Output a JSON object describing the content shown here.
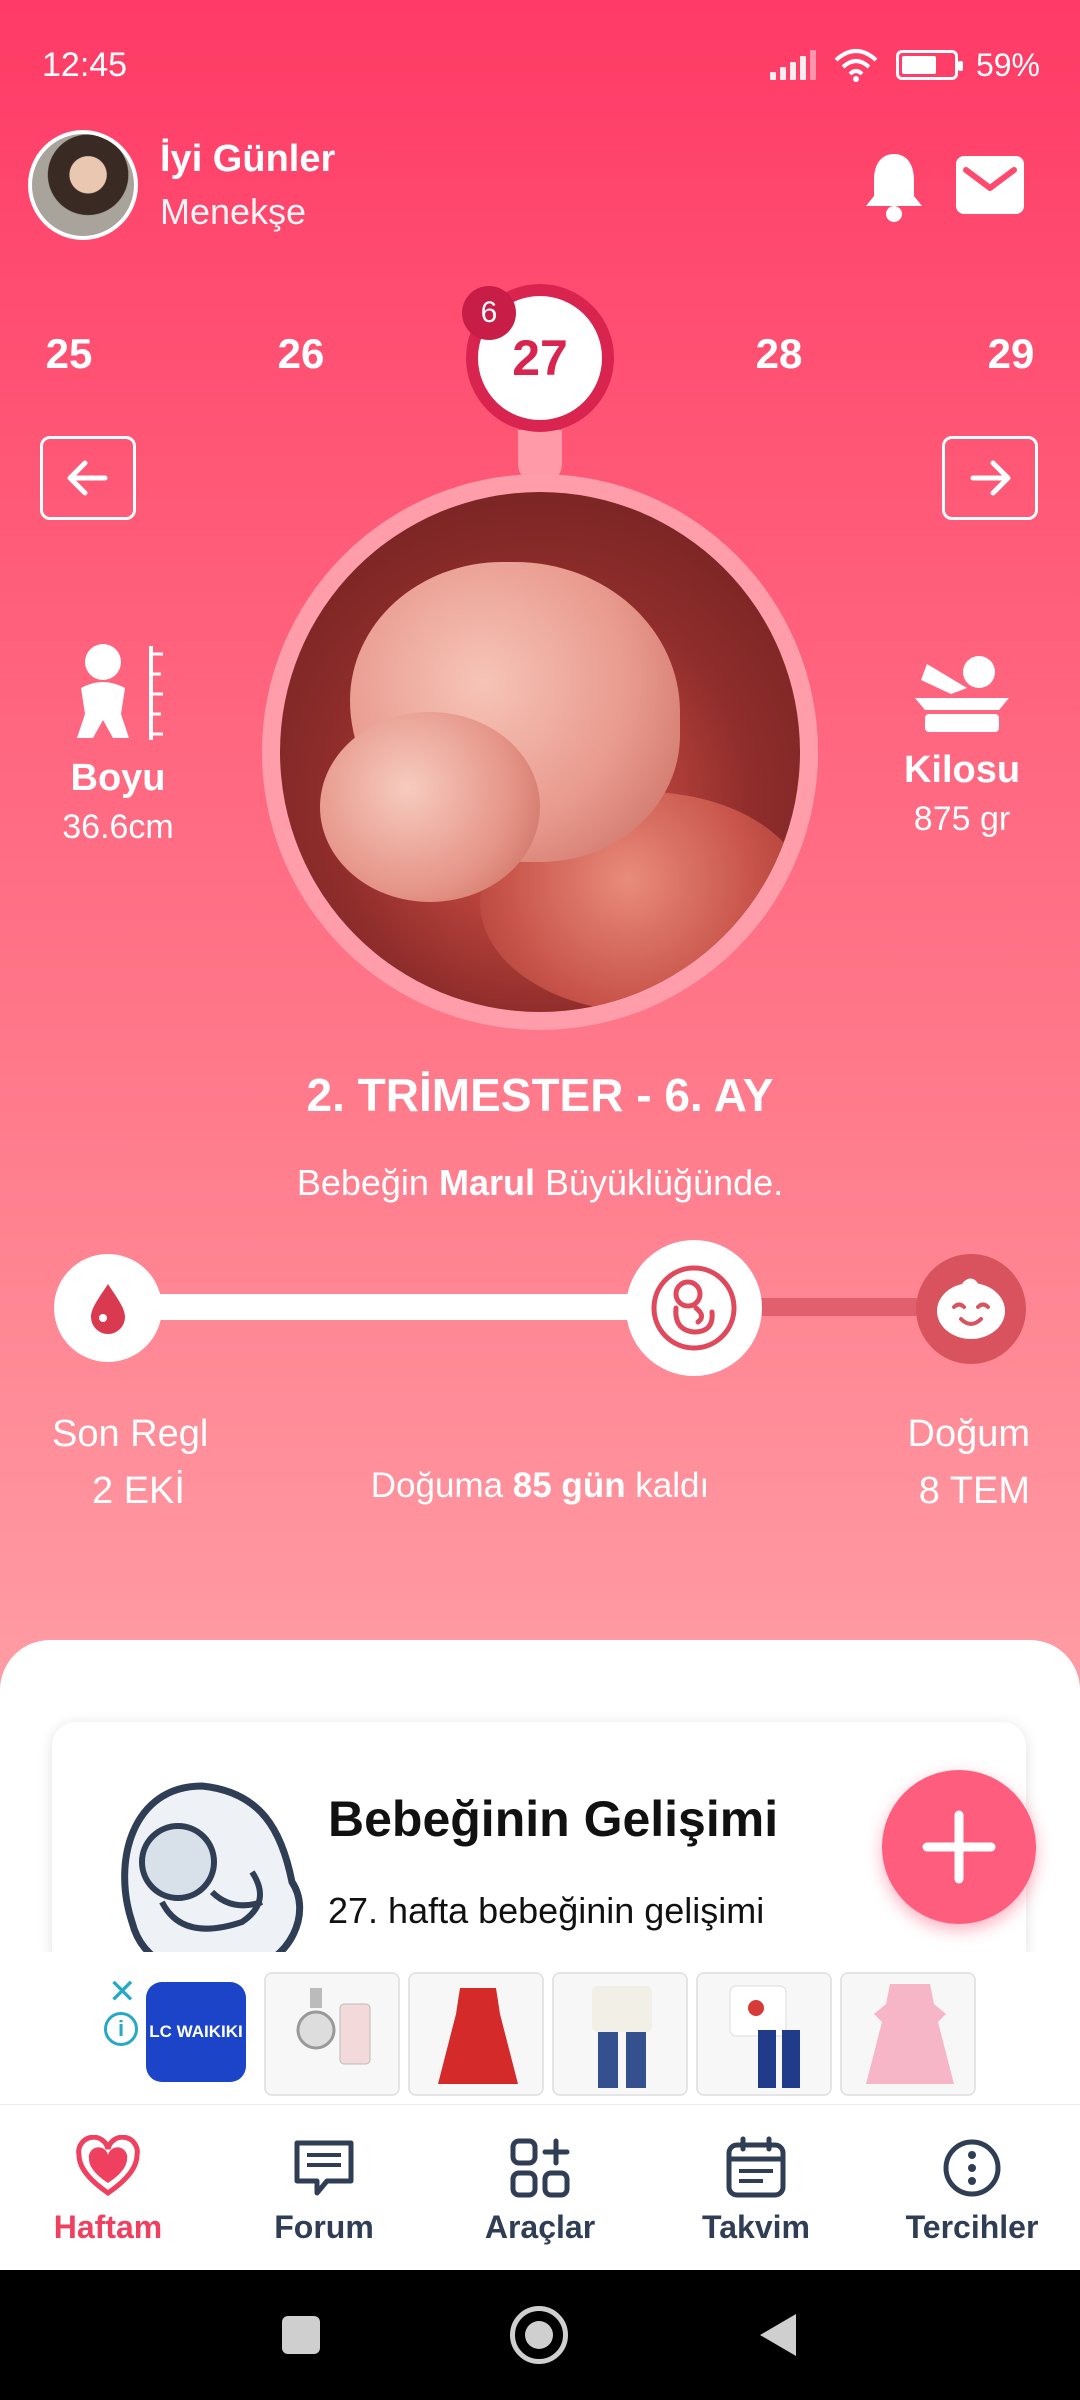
{
  "status_bar": {
    "time": "12:45",
    "battery": "59%"
  },
  "header": {
    "greeting": "İyi Günler",
    "user_name": "Menekşe"
  },
  "weeks": {
    "items": [
      "25",
      "26",
      "27",
      "28",
      "29"
    ],
    "current": "27",
    "badge": "6"
  },
  "baby": {
    "length_label": "Boyu",
    "length_value": "36.6cm",
    "weight_label": "Kilosu",
    "weight_value": "875 gr"
  },
  "trimester": "2. TRİMESTER - 6. AY",
  "size_compare": {
    "prefix": "Bebeğin ",
    "fruit": "Marul",
    "suffix": " Büyüklüğünde."
  },
  "timeline": {
    "start_label": "Son Regl",
    "start_date": "2 EKİ",
    "end_label": "Doğum",
    "end_date": "8 TEM",
    "countdown_prefix": "Doğuma ",
    "countdown_value": "85 gün",
    "countdown_suffix": " kaldı",
    "progress": 0.68
  },
  "card": {
    "title": "Bebeğinin Gelişimi",
    "subtitle": "27. hafta bebeğinin gelişimi"
  },
  "ad": {
    "brand": "LC WAIKIKI"
  },
  "bottom_nav": [
    {
      "label": "Haftam",
      "icon": "heart-icon"
    },
    {
      "label": "Forum",
      "icon": "chat-icon"
    },
    {
      "label": "Araçlar",
      "icon": "tools-grid-icon"
    },
    {
      "label": "Takvim",
      "icon": "calendar-icon"
    },
    {
      "label": "Tercihler",
      "icon": "more-vertical-icon"
    }
  ],
  "colors": {
    "primary": "#f0405f",
    "accent_dark": "#d8244e",
    "nav_text": "#2f3e55"
  }
}
